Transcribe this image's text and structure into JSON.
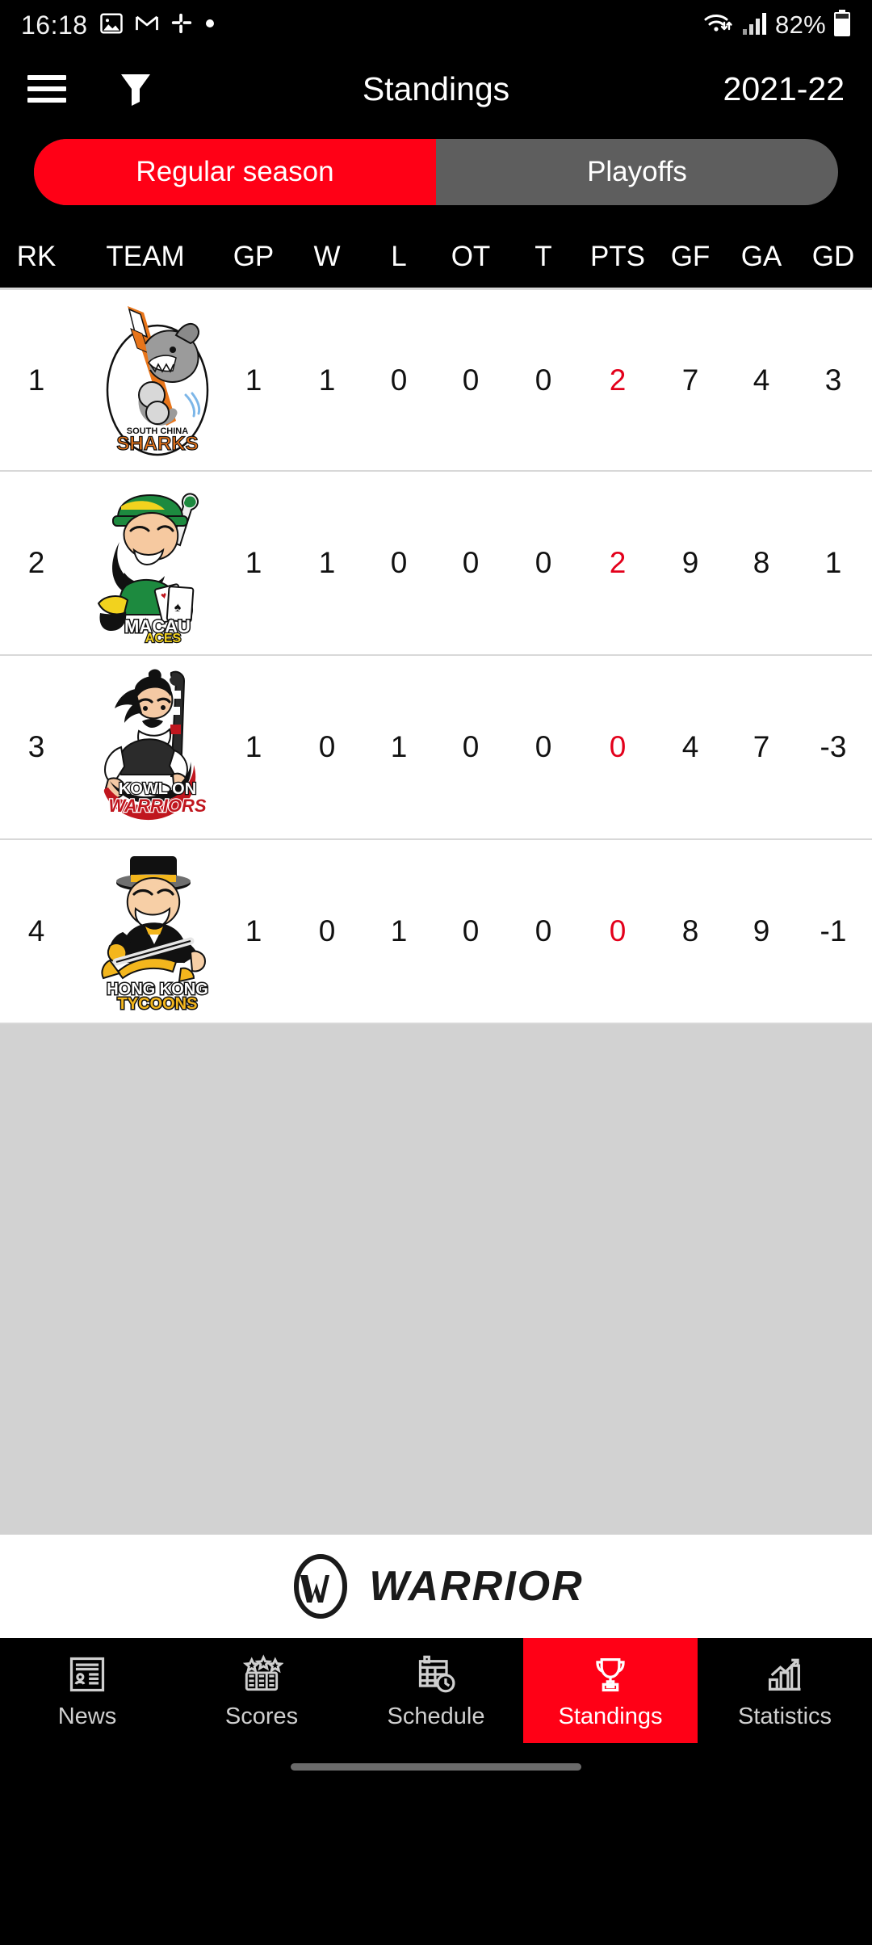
{
  "status_bar": {
    "time": "16:18",
    "battery_percent": "82%",
    "icons": [
      "photos-icon",
      "gmail-icon",
      "slack-icon",
      "dot-icon",
      "wifi-icon",
      "signal-icon",
      "battery-icon"
    ]
  },
  "app_bar": {
    "menu_icon": "hamburger-menu-icon",
    "filter_icon": "filter-icon",
    "title": "Standings",
    "season": "2021-22"
  },
  "segmented": {
    "options": [
      "Regular season",
      "Playoffs"
    ],
    "selected": "Regular season",
    "active_color": "#ff0016",
    "inactive_color": "#5e5e5e"
  },
  "table": {
    "columns": [
      "RK",
      "TEAM",
      "GP",
      "W",
      "L",
      "OT",
      "T",
      "PTS",
      "GF",
      "GA",
      "GD"
    ],
    "pts_color": "#e3001b",
    "rows": [
      {
        "rk": "1",
        "team": "South China Sharks",
        "logo": "south-china-sharks-logo",
        "gp": "1",
        "w": "1",
        "l": "0",
        "ot": "0",
        "t": "0",
        "pts": "2",
        "gf": "7",
        "ga": "4",
        "gd": "3"
      },
      {
        "rk": "2",
        "team": "Macau Aces",
        "logo": "macau-aces-logo",
        "gp": "1",
        "w": "1",
        "l": "0",
        "ot": "0",
        "t": "0",
        "pts": "2",
        "gf": "9",
        "ga": "8",
        "gd": "1"
      },
      {
        "rk": "3",
        "team": "Kowloon Warriors",
        "logo": "kowloon-warriors-logo",
        "gp": "1",
        "w": "0",
        "l": "1",
        "ot": "0",
        "t": "0",
        "pts": "0",
        "gf": "4",
        "ga": "7",
        "gd": "-3"
      },
      {
        "rk": "4",
        "team": "Hong Kong Tycoons",
        "logo": "hong-kong-tycoons-logo",
        "gp": "1",
        "w": "0",
        "l": "1",
        "ot": "0",
        "t": "0",
        "pts": "0",
        "gf": "8",
        "ga": "9",
        "gd": "-1"
      }
    ]
  },
  "sponsor": {
    "name": "WARRIOR",
    "trademark": "®",
    "logo": "warrior-w-oval-logo"
  },
  "bottom_nav": {
    "items": [
      {
        "label": "News",
        "icon": "newspaper-icon",
        "active": false
      },
      {
        "label": "Scores",
        "icon": "scoreboard-icon",
        "active": false
      },
      {
        "label": "Schedule",
        "icon": "calendar-clock-icon",
        "active": false
      },
      {
        "label": "Standings",
        "icon": "trophy-icon",
        "active": true
      },
      {
        "label": "Statistics",
        "icon": "bar-chart-icon",
        "active": false
      }
    ],
    "active_color": "#ff0016"
  },
  "team_logos": {
    "south_china_sharks": {
      "text_top": "SOUTH CHINA",
      "text_main": "SHARKS"
    },
    "macau_aces": {
      "text_top": "MACAU",
      "text_main": "ACES"
    },
    "kowloon_warriors": {
      "text_top": "KOWLOON",
      "text_main": "WARRIORS"
    },
    "hong_kong_tycoons": {
      "text_top": "HONG KONG",
      "text_main": "TYCOONS"
    }
  }
}
